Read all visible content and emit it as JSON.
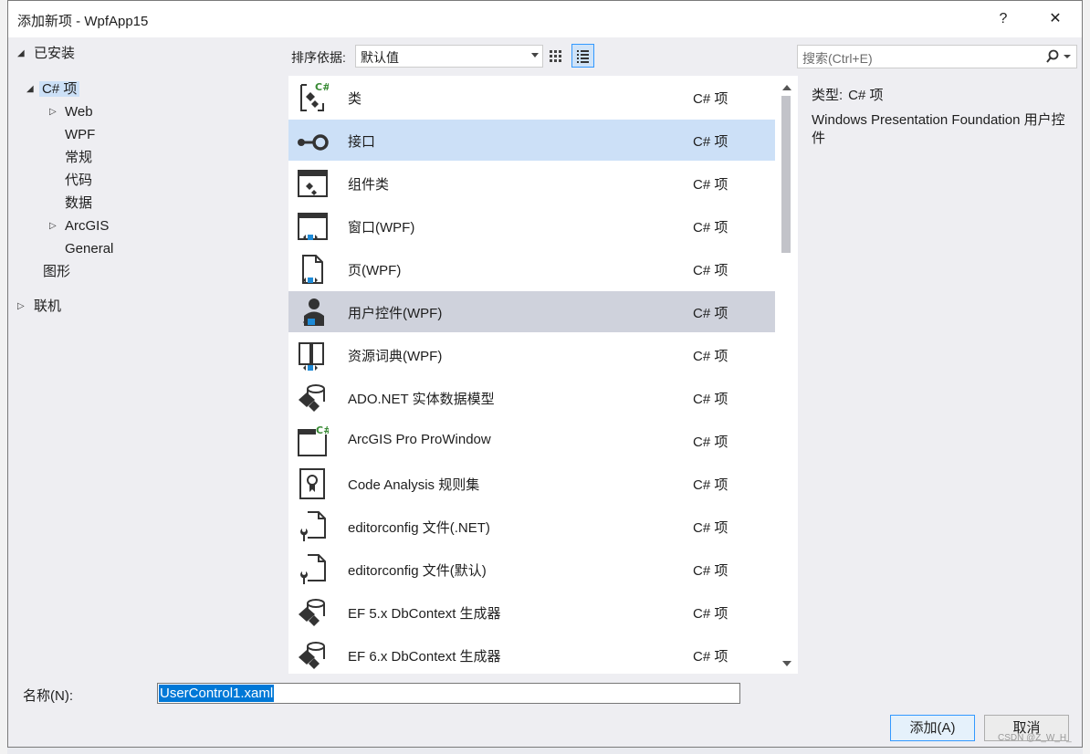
{
  "dialog": {
    "title": "添加新项 - WpfApp15",
    "help_label": "?",
    "close_label": "✕"
  },
  "tree": {
    "installed": "已安装",
    "csharp": "C# 项",
    "children": [
      "Web",
      "WPF",
      "常规",
      "代码",
      "数据",
      "ArcGIS",
      "General"
    ],
    "graphics": "图形",
    "online": "联机"
  },
  "toolbar": {
    "sort_label": "排序依据:",
    "sort_value": "默认值"
  },
  "search": {
    "placeholder": "搜索(Ctrl+E)"
  },
  "items": [
    {
      "name": "类",
      "type": "C# 项",
      "icon": "class-icon"
    },
    {
      "name": "接口",
      "type": "C# 项",
      "icon": "interface-icon"
    },
    {
      "name": "组件类",
      "type": "C# 项",
      "icon": "component-icon"
    },
    {
      "name": "窗口(WPF)",
      "type": "C# 项",
      "icon": "window-icon"
    },
    {
      "name": "页(WPF)",
      "type": "C# 项",
      "icon": "page-icon"
    },
    {
      "name": "用户控件(WPF)",
      "type": "C# 项",
      "icon": "user-control-icon"
    },
    {
      "name": "资源词典(WPF)",
      "type": "C# 项",
      "icon": "resource-dictionary-icon"
    },
    {
      "name": "ADO.NET 实体数据模型",
      "type": "C# 项",
      "icon": "data-model-icon"
    },
    {
      "name": "ArcGIS Pro ProWindow",
      "type": "C# 项",
      "icon": "prowindow-icon"
    },
    {
      "name": "Code Analysis 规则集",
      "type": "C# 项",
      "icon": "ruleset-icon"
    },
    {
      "name": "editorconfig 文件(.NET)",
      "type": "C# 项",
      "icon": "config-file-icon"
    },
    {
      "name": "editorconfig 文件(默认)",
      "type": "C# 项",
      "icon": "config-file-icon"
    },
    {
      "name": "EF 5.x DbContext 生成器",
      "type": "C# 项",
      "icon": "generator-icon"
    },
    {
      "name": "EF 6.x DbContext 生成器",
      "type": "C# 项",
      "icon": "generator-icon"
    }
  ],
  "info": {
    "type_label": "类型:",
    "type_value": "C# 项",
    "description": "Windows Presentation Foundation 用户控件"
  },
  "bottom": {
    "name_label": "名称(N):",
    "name_value": "UserControl1.xaml",
    "add_label": "添加(A)",
    "cancel_label": "取消"
  },
  "watermark": "CSDN @Z_W_H_"
}
